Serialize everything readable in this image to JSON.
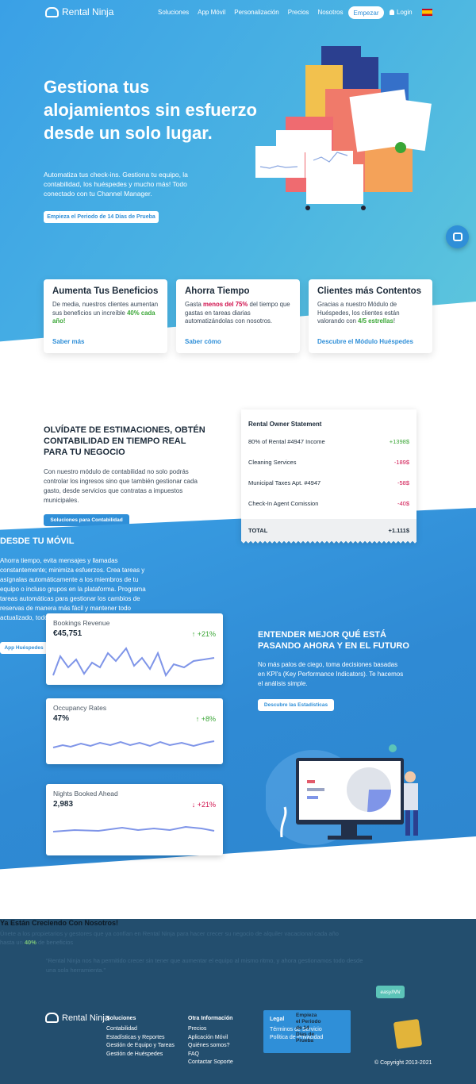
{
  "nav": {
    "brand": "Rental Ninja",
    "links": [
      "Soluciones",
      "App Móvil",
      "Personalización",
      "Precios",
      "Nosotros"
    ],
    "cta": "Empezar",
    "login": "Login"
  },
  "hero": {
    "title": "Gestiona tus alojamientos sin esfuerzo desde un solo lugar.",
    "subtitle": "Automatiza tus check-ins. Gestiona tu equipo, la contabilidad, los huéspedes y mucho más! Todo conectado con tu Channel Manager.",
    "cta": "Empieza el Periodo de 14 Días de Prueba"
  },
  "features": [
    {
      "title": "Aumenta Tus Beneficios",
      "text_a": "De media, nuestros clientes aumentan sus beneficios un increíble ",
      "highlight": "40% cada año!",
      "text_b": "",
      "link": "Saber más"
    },
    {
      "title": "Ahorra Tiempo",
      "text_a": "Gasta ",
      "highlight": "menos del 75%",
      "text_b": " del tiempo que gastas en tareas diarias automatizándolas con nosotros.",
      "link": "Saber cómo"
    },
    {
      "title": "Clientes más Contentos",
      "text_a": "Gracias a nuestro Módulo de Huéspedes, los clientes están valorando con ",
      "highlight": "4/5 estrellas",
      "text_b": "!",
      "link": "Descubre el Módulo Huéspedes"
    }
  ],
  "accounting": {
    "title": "OLVÍDATE DE ESTIMACIONES, OBTÉN CONTABILIDAD EN TIEMPO REAL PARA TU NEGOCIO",
    "text": "Con nuestro módulo de contabilidad no solo podrás controlar los ingresos sino que también gestionar cada gasto, desde servicios que contratas a impuestos municipales.",
    "cta": "Soluciones para Contabilidad",
    "statement": {
      "title": "Rental Owner Statement",
      "rows": [
        {
          "label": "80% of Rental #4947 Income",
          "amount": "+1398$"
        },
        {
          "label": "Cleaning Services",
          "amount": "-189$"
        },
        {
          "label": "Municipal Taxes Apt. #4947",
          "amount": "-58$"
        },
        {
          "label": "Check-In Agent Comission",
          "amount": "-40$"
        }
      ],
      "total_label": "TOTAL",
      "total_value": "+1.111$"
    }
  },
  "mobile": {
    "title": "DESDE TU MÓVIL",
    "text": "Ahorra tiempo, evita mensajes y llamadas constantemente; minimiza esfuerzos. Crea tareas y asígnalas automáticamente a los miembros de tu equipo o incluso grupos en la plataforma. Programa tareas automáticas para gestionar los cambios de reservas de manera más fácil y mantener todo actualizado, todo desde tu bolsillo, desde tu móvil.",
    "cta": "App Huéspedes"
  },
  "kpis": [
    {
      "label": "Bookings Revenue",
      "value": "€45,751",
      "delta": "+21%",
      "direction": "up"
    },
    {
      "label": "Occupancy Rates",
      "value": "47%",
      "delta": "+8%",
      "direction": "up"
    },
    {
      "label": "Nights Booked Ahead",
      "value": "2,983",
      "delta": "+21%",
      "direction": "down"
    }
  ],
  "stats": {
    "title": "ENTENDER MEJOR QUÉ ESTÁ PASANDO AHORA Y EN EL FUTURO",
    "text": "No más palos de ciego, toma decisiones basadas en KPI's (Key Performance Indicators). Te hacemos el análisis simple.",
    "cta": "Descubre las Estadísticas"
  },
  "growing": {
    "title": "Ya Están Creciendo Con Nosotros!",
    "sub": "Únete a los propietarios y gestores que ya confían en Rental Ninja para hacer crecer su negocio de alquiler vacacional cada año",
    "sub2_a": "hasta un ",
    "sub2_b": "40%",
    "sub2_c": " de beneficios",
    "quote": "“Rental Ninja nos ha permitido crecer sin tener que aumentar el equipo al mismo ritmo, y ahora gestionamos todo desde una sola herramienta.”",
    "partner": "easyINN"
  },
  "footer": {
    "brand": "Rental Ninja",
    "col1": {
      "title": "Soluciones",
      "items": [
        "Contabilidad",
        "Estadísticas y Reportes",
        "Gestión de Equipo y Tareas",
        "Gestión de Huéspedes"
      ]
    },
    "col2": {
      "title": "Otra Información",
      "items": [
        "Precios",
        "Aplicación Móvil",
        "Quiénes somos?",
        "FAQ",
        "Contactar Soporte"
      ]
    },
    "legal": {
      "title": "Legal",
      "items": [
        "Términos de Servicio",
        "Política de Privacidad"
      ]
    },
    "trial": "Empieza el Periodo de 14 Días de Prueba",
    "copyright": "© Copyright 2013-2021"
  },
  "colors": {
    "primary": "#2f8fd8",
    "green": "#3aa636",
    "red": "#d0104c",
    "footer": "#234e6e"
  }
}
